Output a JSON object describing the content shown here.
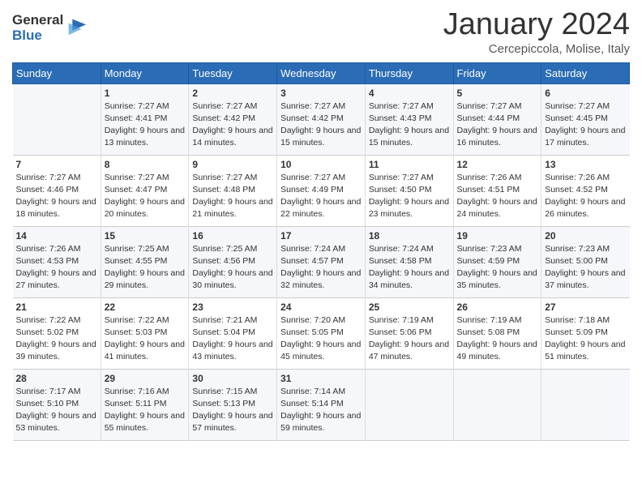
{
  "header": {
    "logo_general": "General",
    "logo_blue": "Blue",
    "month_title": "January 2024",
    "location": "Cercepiccola, Molise, Italy"
  },
  "weekdays": [
    "Sunday",
    "Monday",
    "Tuesday",
    "Wednesday",
    "Thursday",
    "Friday",
    "Saturday"
  ],
  "weeks": [
    [
      {
        "day": "",
        "sunrise": "",
        "sunset": "",
        "daylight": ""
      },
      {
        "day": "1",
        "sunrise": "7:27 AM",
        "sunset": "4:41 PM",
        "daylight": "9 hours and 13 minutes."
      },
      {
        "day": "2",
        "sunrise": "7:27 AM",
        "sunset": "4:42 PM",
        "daylight": "9 hours and 14 minutes."
      },
      {
        "day": "3",
        "sunrise": "7:27 AM",
        "sunset": "4:42 PM",
        "daylight": "9 hours and 15 minutes."
      },
      {
        "day": "4",
        "sunrise": "7:27 AM",
        "sunset": "4:43 PM",
        "daylight": "9 hours and 15 minutes."
      },
      {
        "day": "5",
        "sunrise": "7:27 AM",
        "sunset": "4:44 PM",
        "daylight": "9 hours and 16 minutes."
      },
      {
        "day": "6",
        "sunrise": "7:27 AM",
        "sunset": "4:45 PM",
        "daylight": "9 hours and 17 minutes."
      }
    ],
    [
      {
        "day": "7",
        "sunrise": "7:27 AM",
        "sunset": "4:46 PM",
        "daylight": "9 hours and 18 minutes."
      },
      {
        "day": "8",
        "sunrise": "7:27 AM",
        "sunset": "4:47 PM",
        "daylight": "9 hours and 20 minutes."
      },
      {
        "day": "9",
        "sunrise": "7:27 AM",
        "sunset": "4:48 PM",
        "daylight": "9 hours and 21 minutes."
      },
      {
        "day": "10",
        "sunrise": "7:27 AM",
        "sunset": "4:49 PM",
        "daylight": "9 hours and 22 minutes."
      },
      {
        "day": "11",
        "sunrise": "7:27 AM",
        "sunset": "4:50 PM",
        "daylight": "9 hours and 23 minutes."
      },
      {
        "day": "12",
        "sunrise": "7:26 AM",
        "sunset": "4:51 PM",
        "daylight": "9 hours and 24 minutes."
      },
      {
        "day": "13",
        "sunrise": "7:26 AM",
        "sunset": "4:52 PM",
        "daylight": "9 hours and 26 minutes."
      }
    ],
    [
      {
        "day": "14",
        "sunrise": "7:26 AM",
        "sunset": "4:53 PM",
        "daylight": "9 hours and 27 minutes."
      },
      {
        "day": "15",
        "sunrise": "7:25 AM",
        "sunset": "4:55 PM",
        "daylight": "9 hours and 29 minutes."
      },
      {
        "day": "16",
        "sunrise": "7:25 AM",
        "sunset": "4:56 PM",
        "daylight": "9 hours and 30 minutes."
      },
      {
        "day": "17",
        "sunrise": "7:24 AM",
        "sunset": "4:57 PM",
        "daylight": "9 hours and 32 minutes."
      },
      {
        "day": "18",
        "sunrise": "7:24 AM",
        "sunset": "4:58 PM",
        "daylight": "9 hours and 34 minutes."
      },
      {
        "day": "19",
        "sunrise": "7:23 AM",
        "sunset": "4:59 PM",
        "daylight": "9 hours and 35 minutes."
      },
      {
        "day": "20",
        "sunrise": "7:23 AM",
        "sunset": "5:00 PM",
        "daylight": "9 hours and 37 minutes."
      }
    ],
    [
      {
        "day": "21",
        "sunrise": "7:22 AM",
        "sunset": "5:02 PM",
        "daylight": "9 hours and 39 minutes."
      },
      {
        "day": "22",
        "sunrise": "7:22 AM",
        "sunset": "5:03 PM",
        "daylight": "9 hours and 41 minutes."
      },
      {
        "day": "23",
        "sunrise": "7:21 AM",
        "sunset": "5:04 PM",
        "daylight": "9 hours and 43 minutes."
      },
      {
        "day": "24",
        "sunrise": "7:20 AM",
        "sunset": "5:05 PM",
        "daylight": "9 hours and 45 minutes."
      },
      {
        "day": "25",
        "sunrise": "7:19 AM",
        "sunset": "5:06 PM",
        "daylight": "9 hours and 47 minutes."
      },
      {
        "day": "26",
        "sunrise": "7:19 AM",
        "sunset": "5:08 PM",
        "daylight": "9 hours and 49 minutes."
      },
      {
        "day": "27",
        "sunrise": "7:18 AM",
        "sunset": "5:09 PM",
        "daylight": "9 hours and 51 minutes."
      }
    ],
    [
      {
        "day": "28",
        "sunrise": "7:17 AM",
        "sunset": "5:10 PM",
        "daylight": "9 hours and 53 minutes."
      },
      {
        "day": "29",
        "sunrise": "7:16 AM",
        "sunset": "5:11 PM",
        "daylight": "9 hours and 55 minutes."
      },
      {
        "day": "30",
        "sunrise": "7:15 AM",
        "sunset": "5:13 PM",
        "daylight": "9 hours and 57 minutes."
      },
      {
        "day": "31",
        "sunrise": "7:14 AM",
        "sunset": "5:14 PM",
        "daylight": "9 hours and 59 minutes."
      },
      {
        "day": "",
        "sunrise": "",
        "sunset": "",
        "daylight": ""
      },
      {
        "day": "",
        "sunrise": "",
        "sunset": "",
        "daylight": ""
      },
      {
        "day": "",
        "sunrise": "",
        "sunset": "",
        "daylight": ""
      }
    ]
  ],
  "labels": {
    "sunrise_prefix": "Sunrise: ",
    "sunset_prefix": "Sunset: ",
    "daylight_prefix": "Daylight: "
  }
}
